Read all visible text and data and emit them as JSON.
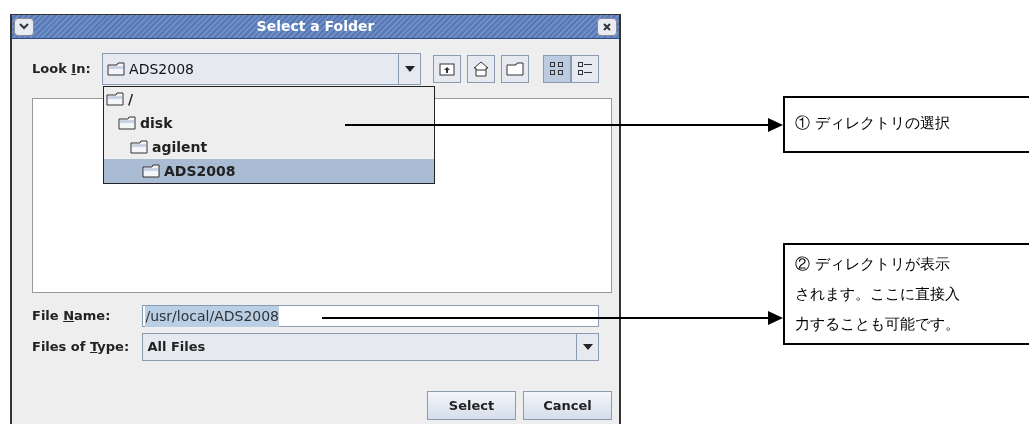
{
  "window": {
    "title": "Select a Folder"
  },
  "look_in": {
    "label": {
      "before": "Look ",
      "key": "I",
      "after": "n:"
    },
    "value": "ADS2008"
  },
  "toolbar": [
    {
      "kind": "up",
      "selected": false
    },
    {
      "kind": "home",
      "selected": false
    },
    {
      "kind": "newfolder",
      "selected": false
    },
    {
      "kind": "list",
      "selected": true
    },
    {
      "kind": "details",
      "selected": false
    }
  ],
  "dropdown": {
    "items": [
      {
        "label": "/",
        "selected": false,
        "children": [
          {
            "label": "disk",
            "selected": false,
            "children": [
              {
                "label": "agilent",
                "selected": false,
                "children": [
                  {
                    "label": "ADS2008",
                    "selected": true
                  }
                ]
              }
            ]
          }
        ]
      }
    ]
  },
  "file_name": {
    "label": {
      "before": "File ",
      "key": "N",
      "after": "ame:"
    },
    "value": "/usr/local/ADS2008",
    "value_selected": true
  },
  "files_of_type": {
    "label": {
      "before": "Files of ",
      "key": "T",
      "after": "ype:"
    },
    "value": "All Files"
  },
  "buttons": [
    "Select",
    "Cancel"
  ],
  "callouts": [
    {
      "lines": [
        "① ディレクトリの選択"
      ]
    },
    {
      "lines": [
        "② ディレクトリが表示",
        "されます。ここに直接入",
        "力することも可能です。"
      ]
    }
  ]
}
